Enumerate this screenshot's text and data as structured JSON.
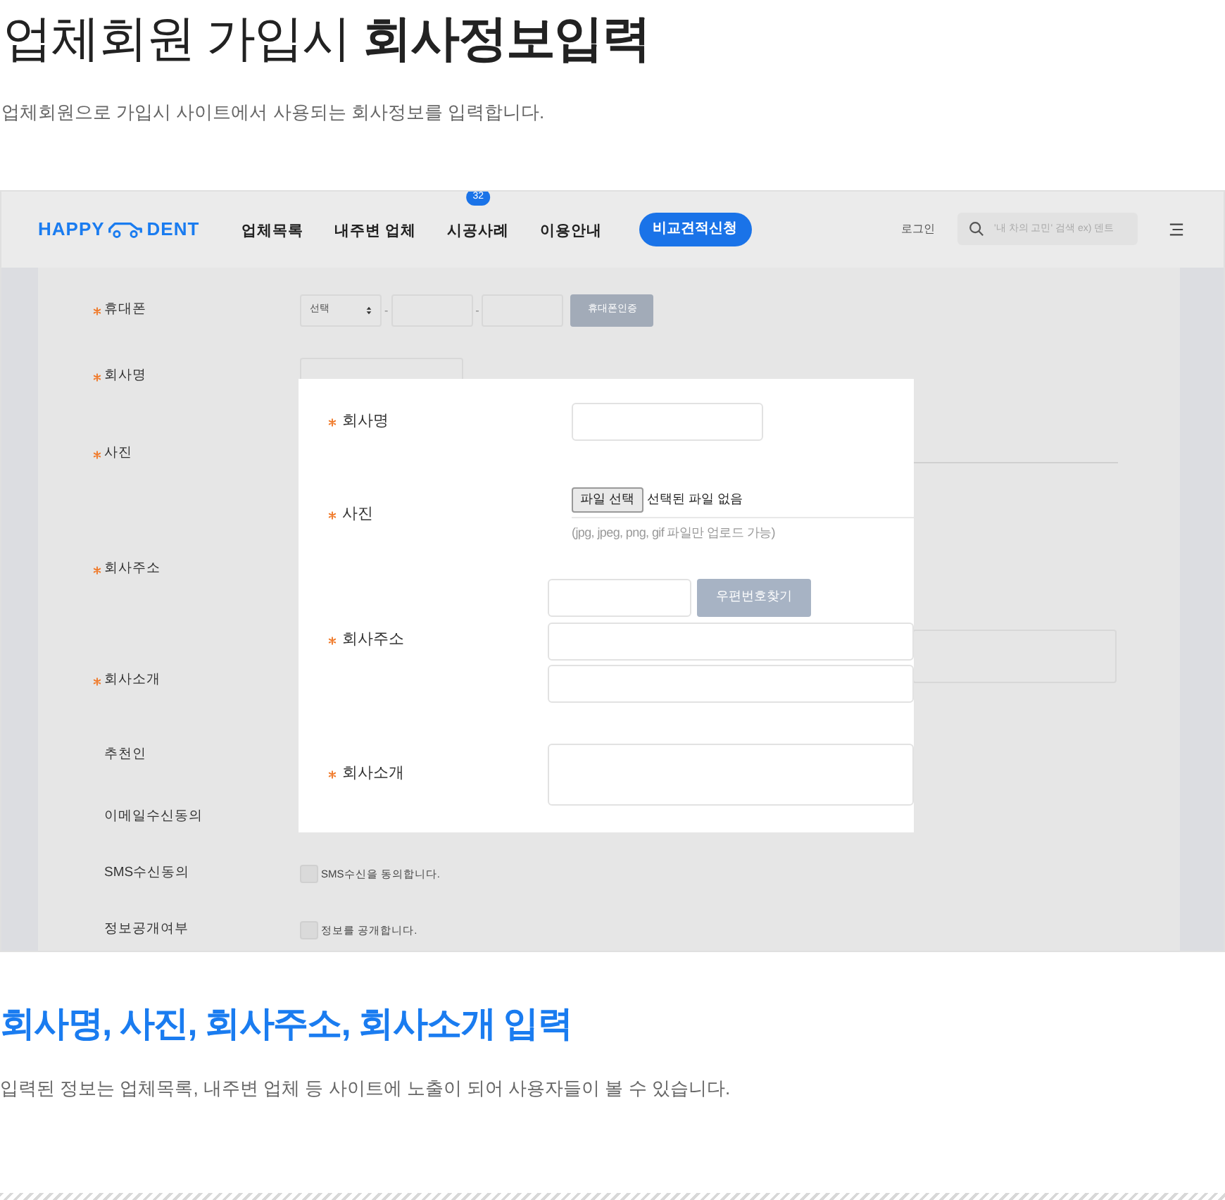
{
  "title": "업체회원 가입시 **회사정보입력**",
  "description": "업체회원으로 가입시 사이트에서 사용되는 회사정보를 입력합니다.",
  "screenshot": {
    "nav": {
      "logo_left": "HAPPY",
      "logo_right": "DENT",
      "menu": [
        {
          "label": "업체목록"
        },
        {
          "label": "내주변 업체"
        },
        {
          "label": "시공사례",
          "badge": "32"
        },
        {
          "label": "이용안내"
        }
      ],
      "cta": "비교견적신청",
      "login": "로그인",
      "search_placeholder": "'내 차의 고민' 검색 ex) 덴트"
    },
    "form_rows": [
      {
        "label": "휴대폰",
        "required": true,
        "kind": "phone",
        "select": "선택",
        "separators": [
          "-",
          "-"
        ],
        "button": "휴대폰인증"
      },
      {
        "label": "회사명",
        "required": true,
        "kind": "text"
      },
      {
        "label": "사진",
        "required": true,
        "kind": "covered"
      },
      {
        "label": "회사주소",
        "required": true,
        "kind": "covered"
      },
      {
        "label": "회사소개",
        "required": true,
        "kind": "textarea"
      },
      {
        "label": "추천인",
        "required": false,
        "kind": "covered"
      },
      {
        "label": "이메일수신동의",
        "required": false,
        "kind": "covered"
      },
      {
        "label": "SMS수신동의",
        "required": false,
        "kind": "checkbox",
        "checked": false,
        "text": "SMS수신을 동의합니다."
      },
      {
        "label": "정보공개여부",
        "required": false,
        "kind": "checkbox",
        "checked": false,
        "text": "정보를 공개합니다."
      }
    ],
    "popup_rows": [
      {
        "label": "회사명",
        "required": true,
        "kind": "text"
      },
      {
        "label": "사진",
        "required": true,
        "kind": "file",
        "button": "파일 선택",
        "status": "선택된 파일 없음",
        "hint": "(jpg, jpeg, png, gif 파일만 업로드 가능)"
      },
      {
        "label": "회사주소",
        "required": true,
        "kind": "address",
        "button": "우편번호찾기"
      },
      {
        "label": "회사소개",
        "required": true,
        "kind": "textarea"
      }
    ]
  },
  "section": {
    "title": "회사명, 사진, 회사주소, 회사소개 입력",
    "description": "입력된 정보는 업체목록, 내주변 업체 등 사이트에 노출이 되어 사용자들이 볼 수 있습니다."
  }
}
